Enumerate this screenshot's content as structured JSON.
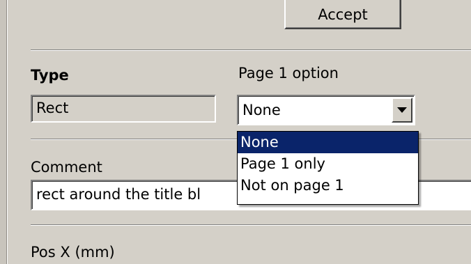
{
  "accept_button": {
    "label": "Accept"
  },
  "type_section": {
    "type_label": "Type",
    "type_value": "Rect",
    "page_option_label": "Page 1 option",
    "page_option_value": "None"
  },
  "page_option_dropdown": {
    "options": [
      "None",
      "Page 1 only",
      "Not on page 1"
    ],
    "selected_index": 0
  },
  "comment_section": {
    "label": "Comment",
    "value": "rect around the title bl"
  },
  "pos_section": {
    "pos_x_label": "Pos X (mm)"
  },
  "colors": {
    "selection": "#0a246a",
    "face": "#d4d0c8"
  }
}
